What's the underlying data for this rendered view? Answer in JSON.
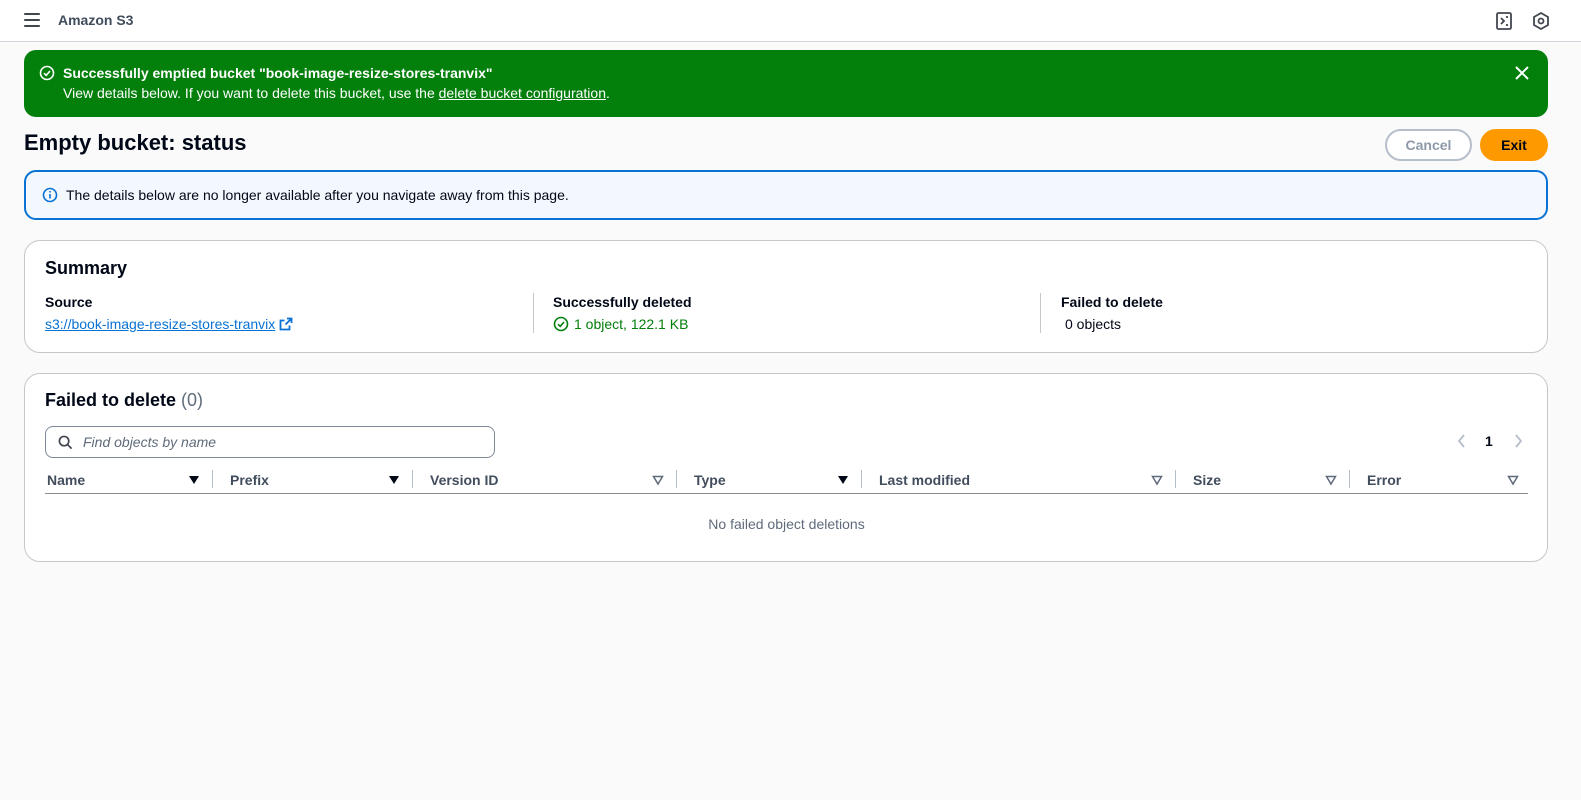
{
  "header": {
    "app_title": "Amazon S3",
    "icons": [
      "menu-icon",
      "notifications-icon",
      "settings-icon"
    ]
  },
  "flash": {
    "title": "Successfully emptied bucket \"book-image-resize-stores-tranvix\"",
    "body_prefix": "View details below. If you want to delete this bucket, use the ",
    "link_text": "delete bucket configuration",
    "body_suffix": ".",
    "color": "#037f0c"
  },
  "page": {
    "title": "Empty bucket: status",
    "cancel_label": "Cancel",
    "exit_label": "Exit",
    "accent": "#ff9900"
  },
  "info": {
    "text": "The details below are no longer available after you navigate away from this page."
  },
  "summary": {
    "title": "Summary",
    "source_label": "Source",
    "source_value": "s3://book-image-resize-stores-tranvix",
    "deleted_label": "Successfully deleted",
    "deleted_value": "1 object, 122.1 KB",
    "failed_label": "Failed to delete",
    "failed_value": "0 objects"
  },
  "failed": {
    "title": "Failed to delete",
    "count": "(0)",
    "search_placeholder": "Find objects by name",
    "page": "1",
    "columns": [
      "Name",
      "Prefix",
      "Version ID",
      "Type",
      "Last modified",
      "Size",
      "Error"
    ],
    "empty_message": "No failed object deletions"
  }
}
